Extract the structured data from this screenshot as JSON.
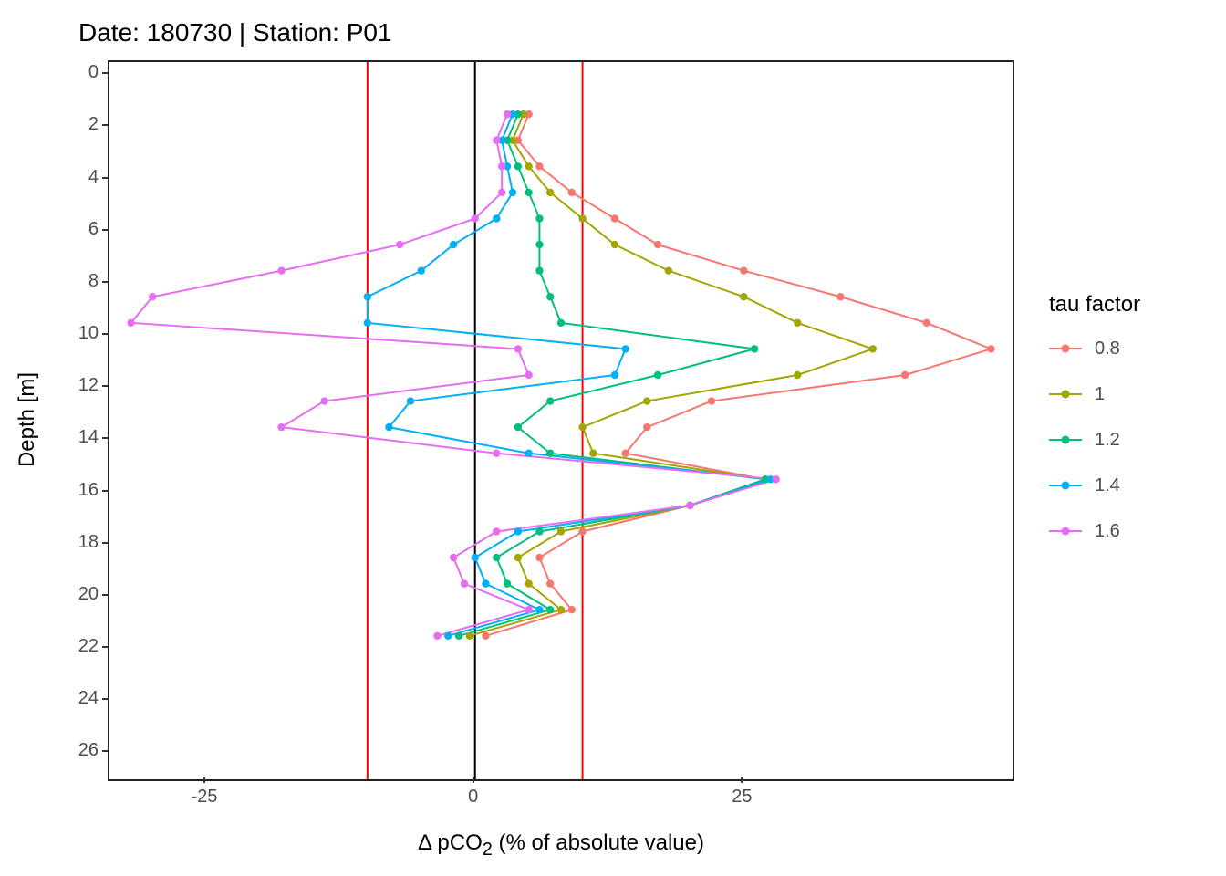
{
  "chart_data": {
    "type": "line",
    "title": "Date: 180730 | Station: P01",
    "xlabel": "Δ pCO₂ (% of absolute value)",
    "ylabel": "Depth [m]",
    "xlim": [
      -34,
      50
    ],
    "ylim": [
      27,
      -0.5
    ],
    "xticks": [
      -25,
      0,
      25
    ],
    "yticks": [
      0,
      2,
      4,
      6,
      8,
      10,
      12,
      14,
      16,
      18,
      20,
      22,
      24,
      26
    ],
    "vlines": [
      {
        "x": -10,
        "color": "#ff0000"
      },
      {
        "x": 0,
        "color": "#000000"
      },
      {
        "x": 10,
        "color": "#ff0000"
      }
    ],
    "legend_title": "tau factor",
    "series": [
      {
        "name": "0.8",
        "color": "#F8766D",
        "depth": [
          1.5,
          2.5,
          3.5,
          4.5,
          5.5,
          6.5,
          7.5,
          8.5,
          9.5,
          10.5,
          11.5,
          12.5,
          13.5,
          14.5,
          15.5,
          16.5,
          17.5,
          18.5,
          19.5,
          20.5,
          21.5
        ],
        "x": [
          5,
          4,
          6,
          9,
          13,
          17,
          25,
          34,
          42,
          48,
          40,
          22,
          16,
          14,
          27,
          20,
          10,
          6,
          7,
          9,
          1
        ]
      },
      {
        "name": "1",
        "color": "#A3A500",
        "depth": [
          1.5,
          2.5,
          3.5,
          4.5,
          5.5,
          6.5,
          7.5,
          8.5,
          9.5,
          10.5,
          11.5,
          12.5,
          13.5,
          14.5,
          15.5,
          16.5,
          17.5,
          18.5,
          19.5,
          20.5,
          21.5
        ],
        "x": [
          4.5,
          3.5,
          5,
          7,
          10,
          13,
          18,
          25,
          30,
          37,
          30,
          16,
          10,
          11,
          27,
          20,
          8,
          4,
          5,
          8,
          -0.5
        ]
      },
      {
        "name": "1.2",
        "color": "#00BF7D",
        "depth": [
          1.5,
          2.5,
          3.5,
          4.5,
          5.5,
          6.5,
          7.5,
          8.5,
          9.5,
          10.5,
          11.5,
          12.5,
          13.5,
          14.5,
          15.5,
          16.5,
          17.5,
          18.5,
          19.5,
          20.5,
          21.5
        ],
        "x": [
          4,
          3,
          4,
          5,
          6,
          6,
          6,
          7,
          8,
          26,
          17,
          7,
          4,
          7,
          27,
          20,
          6,
          2,
          3,
          7,
          -1.5
        ]
      },
      {
        "name": "1.4",
        "color": "#00B0F6",
        "depth": [
          1.5,
          2.5,
          3.5,
          4.5,
          5.5,
          6.5,
          7.5,
          8.5,
          9.5,
          10.5,
          11.5,
          12.5,
          13.5,
          14.5,
          15.5,
          16.5,
          17.5,
          18.5,
          19.5,
          20.5,
          21.5
        ],
        "x": [
          3.5,
          2.5,
          3,
          3.5,
          2,
          -2,
          -5,
          -10,
          -10,
          14,
          13,
          -6,
          -8,
          5,
          27.5,
          20,
          4,
          0,
          1,
          6,
          -2.5
        ]
      },
      {
        "name": "1.6",
        "color": "#E76BF3",
        "depth": [
          1.5,
          2.5,
          3.5,
          4.5,
          5.5,
          6.5,
          7.5,
          8.5,
          9.5,
          10.5,
          11.5,
          12.5,
          13.5,
          14.5,
          15.5,
          16.5,
          17.5,
          18.5,
          19.5,
          20.5,
          21.5
        ],
        "x": [
          3,
          2,
          2.5,
          2.5,
          0,
          -7,
          -18,
          -30,
          -32,
          4,
          5,
          -14,
          -18,
          2,
          28,
          20,
          2,
          -2,
          -1,
          5,
          -3.5
        ]
      }
    ]
  }
}
